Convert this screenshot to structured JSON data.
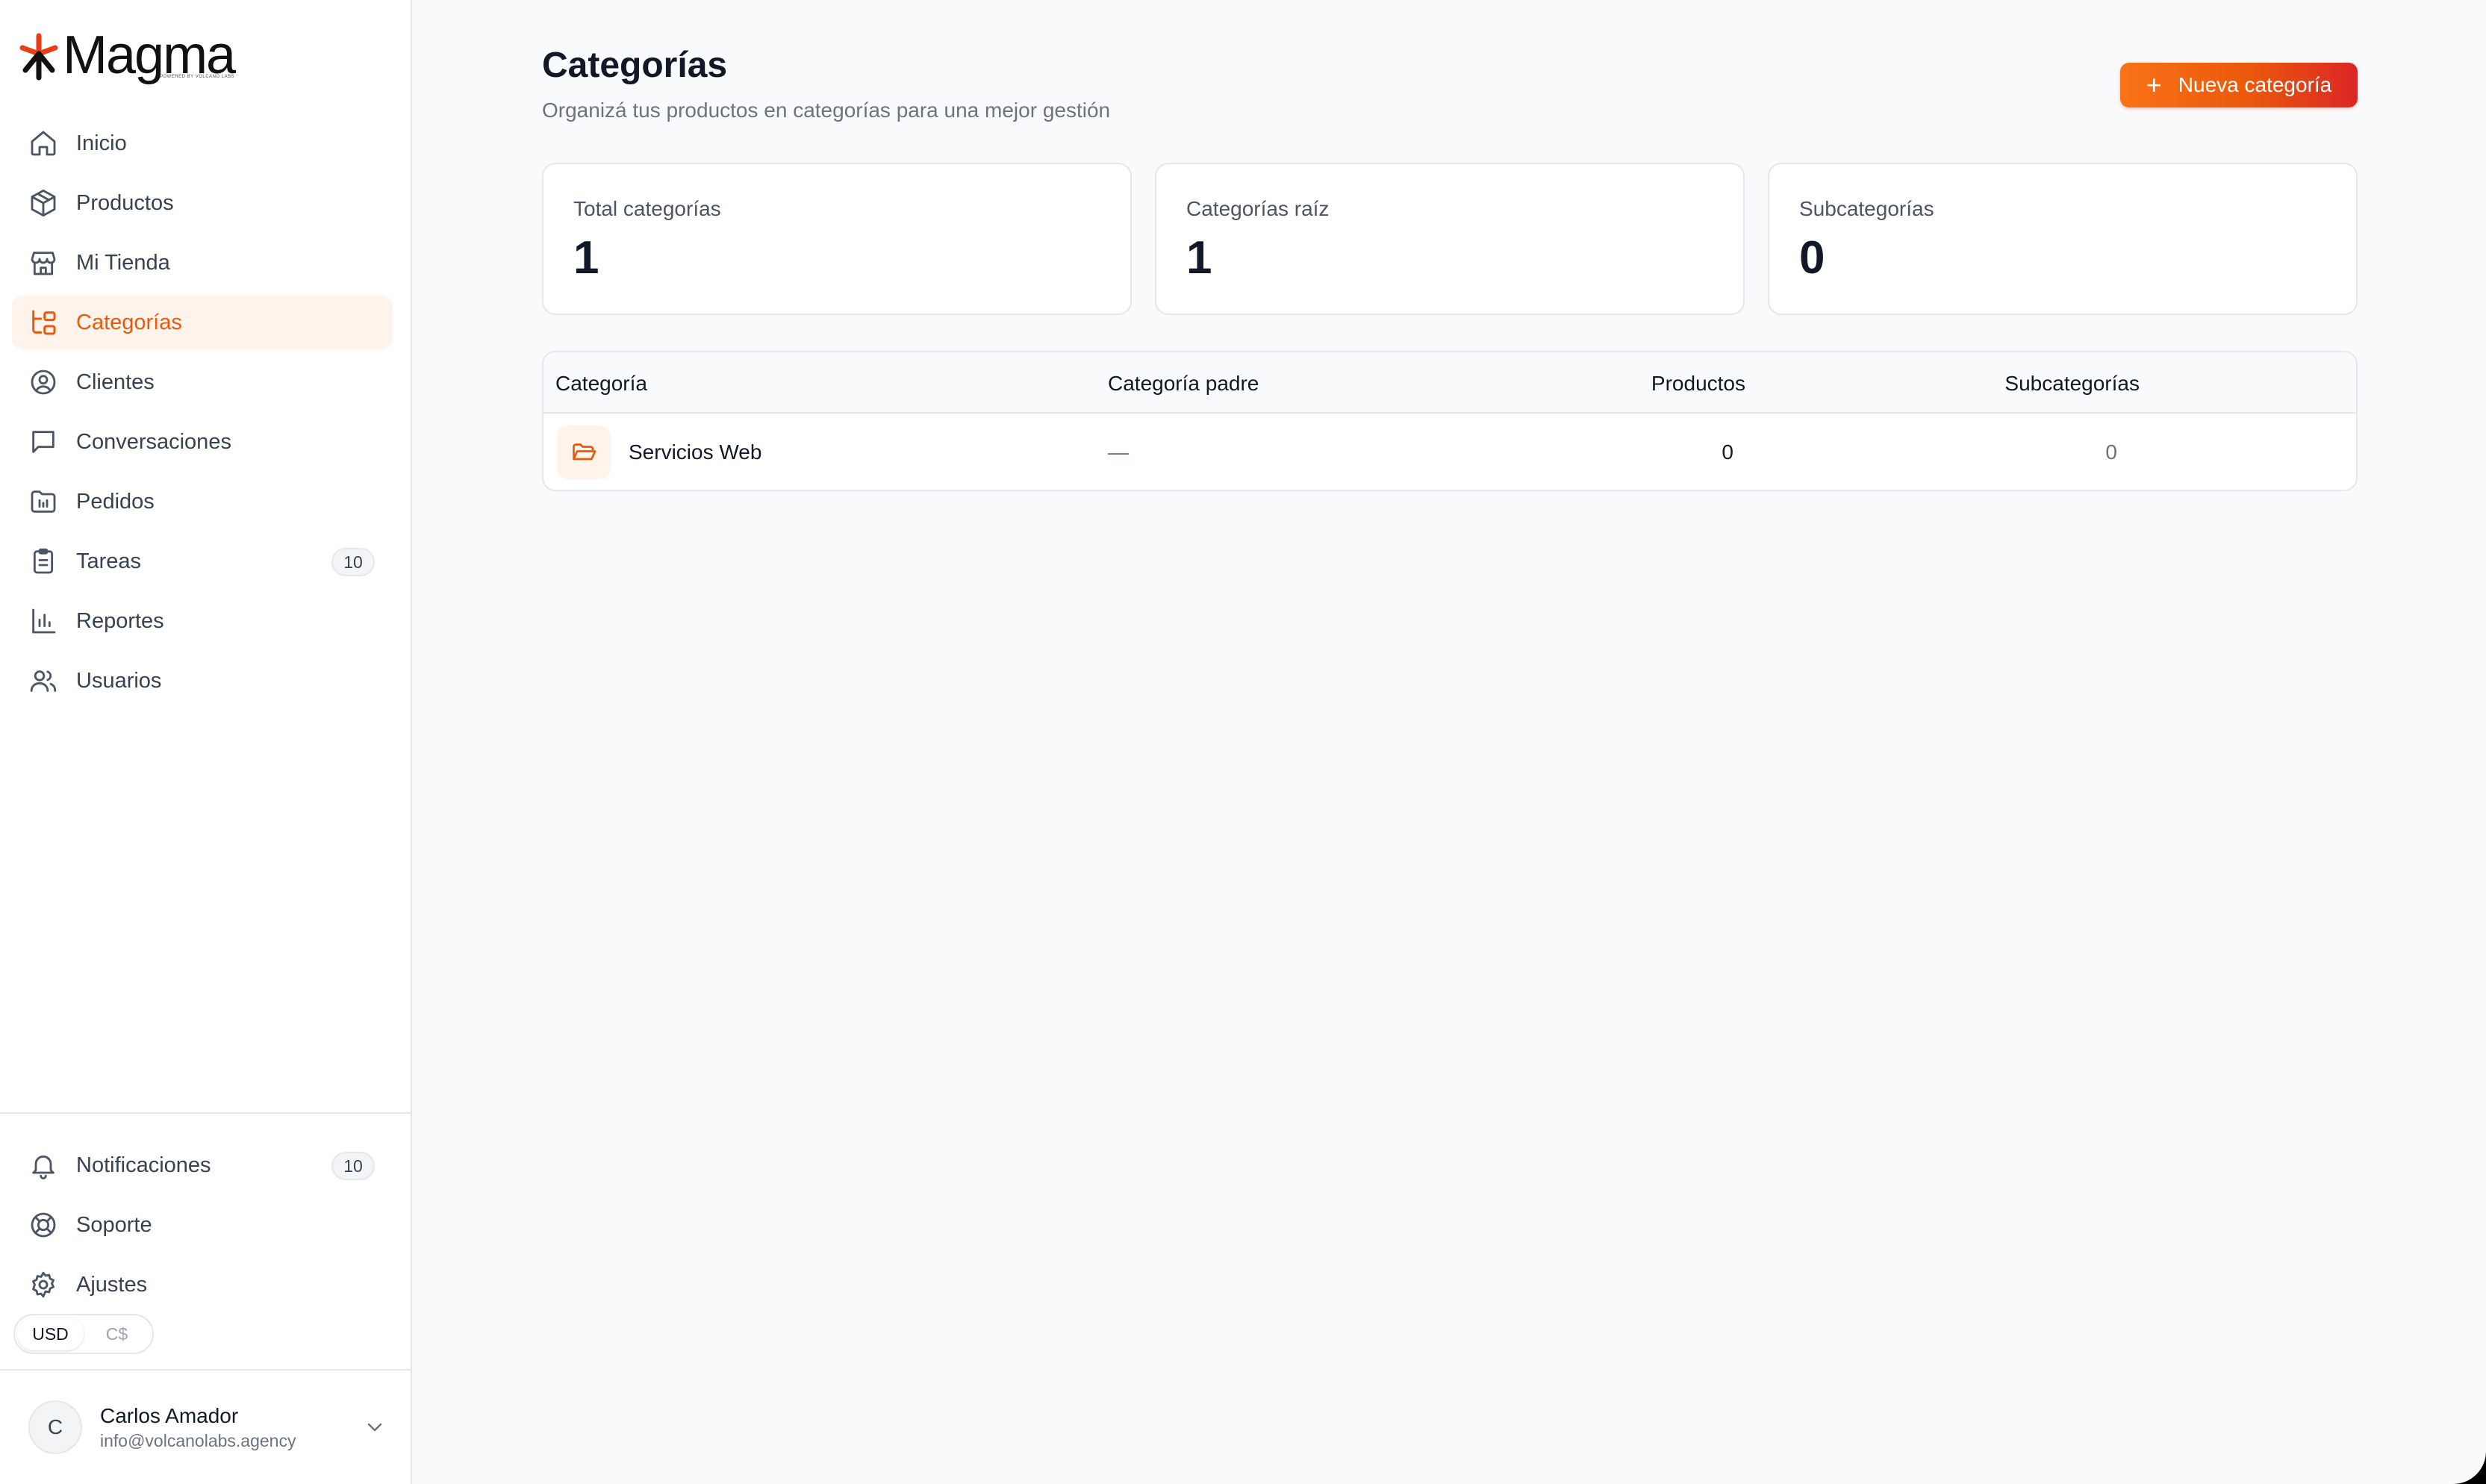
{
  "brand": {
    "name": "Magma",
    "tagline": "POWERED BY VOLCANO LABS",
    "accent": "#ea580c"
  },
  "sidebar": {
    "items": [
      {
        "label": "Inicio",
        "icon": "home-icon"
      },
      {
        "label": "Productos",
        "icon": "box-icon"
      },
      {
        "label": "Mi Tienda",
        "icon": "store-icon"
      },
      {
        "label": "Categorías",
        "icon": "category-tree-icon",
        "active": true
      },
      {
        "label": "Clientes",
        "icon": "user-circle-icon"
      },
      {
        "label": "Conversaciones",
        "icon": "message-square-icon"
      },
      {
        "label": "Pedidos",
        "icon": "orders-icon"
      },
      {
        "label": "Tareas",
        "icon": "clipboard-icon",
        "badge": "10"
      },
      {
        "label": "Reportes",
        "icon": "bar-chart-icon"
      },
      {
        "label": "Usuarios",
        "icon": "users-icon"
      }
    ],
    "bottom_items": [
      {
        "label": "Notificaciones",
        "icon": "bell-icon",
        "badge": "10"
      },
      {
        "label": "Soporte",
        "icon": "life-buoy-icon"
      },
      {
        "label": "Ajustes",
        "icon": "gear-icon"
      }
    ],
    "currency": {
      "options": [
        "USD",
        "C$"
      ],
      "selected": "USD"
    },
    "user": {
      "initial": "C",
      "name": "Carlos Amador",
      "email": "info@volcanolabs.agency"
    }
  },
  "header": {
    "title": "Categorías",
    "subtitle": "Organizá tus productos en categorías para una mejor gestión",
    "new_button": "Nueva categoría"
  },
  "stats": [
    {
      "label": "Total categorías",
      "value": "1"
    },
    {
      "label": "Categorías raíz",
      "value": "1"
    },
    {
      "label": "Subcategorías",
      "value": "0"
    }
  ],
  "table": {
    "columns": [
      "Categoría",
      "Categoría padre",
      "Productos",
      "Subcategorías"
    ],
    "rows": [
      {
        "name": "Servicios Web",
        "parent": "—",
        "products": "0",
        "subcategories": "0"
      }
    ]
  }
}
